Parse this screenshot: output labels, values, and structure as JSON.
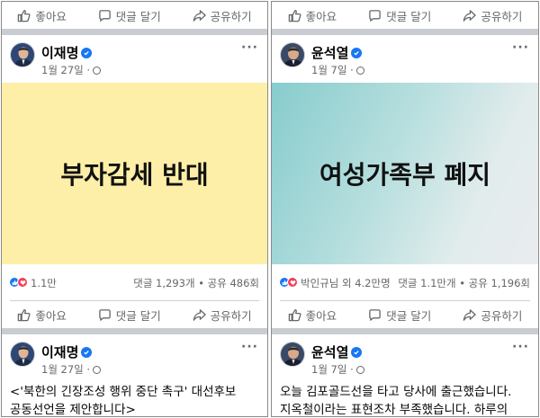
{
  "actions": {
    "like": "좋아요",
    "comment": "댓글 달기",
    "share": "공유하기"
  },
  "left": {
    "post1": {
      "author": "이재명",
      "date": "1월 27일 ·",
      "more": "···",
      "image_text": "부자감세 반대",
      "reaction_count": "1.1만",
      "stats": "댓글 1,293개 • 공유 486회"
    },
    "post2": {
      "author": "이재명",
      "date": "1월 27일 ·",
      "more": "···",
      "text_line1": "<'북한의 긴장조성 행위 중단 촉구' 대선후보",
      "text_line2": "공동선언을 제안합니다>"
    }
  },
  "right": {
    "post1": {
      "author": "윤석열",
      "date": "1월 7일 ·",
      "more": "···",
      "image_text": "여성가족부 폐지",
      "reaction_count": "박인규님 외 4.2만명",
      "stats": "댓글 1.1만개 • 공유 1,196회"
    },
    "post2": {
      "author": "윤석열",
      "date": "1월 7일 ·",
      "more": "···",
      "text_line1": "오늘 김포골드선을 타고 당사에 출근했습니다.",
      "text_line2": "지옥철이라는 표현조차 부족했습니다. 하루의"
    }
  },
  "colors": {
    "facebook_blue": "#1877f2",
    "love_red": "#f33e58",
    "left_image_bg": "#fdefa8",
    "right_image_bg": "#87cccd",
    "secondary_text": "#65676b"
  }
}
